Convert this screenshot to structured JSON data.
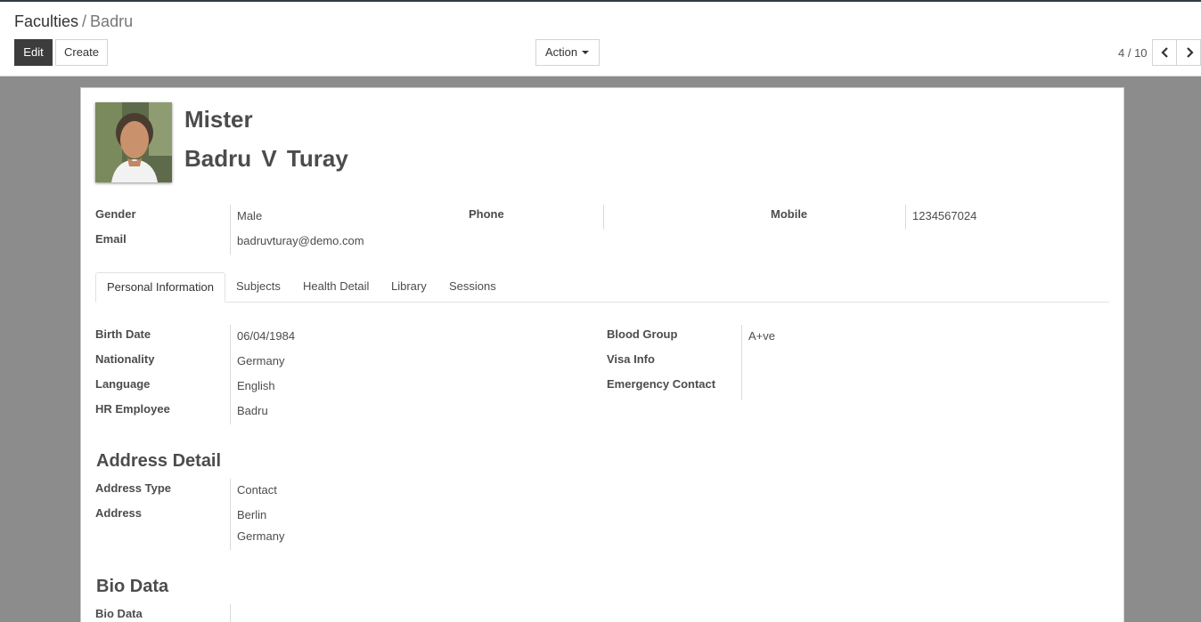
{
  "breadcrumb": {
    "parent": "Faculties",
    "separator": "/",
    "current": "Badru"
  },
  "toolbar": {
    "edit_label": "Edit",
    "create_label": "Create",
    "action_label": "Action"
  },
  "pager": {
    "value": "4 / 10"
  },
  "header": {
    "title": "Mister",
    "name": "Badru  V  Turay"
  },
  "contact": {
    "gender_label": "Gender",
    "gender_value": "Male",
    "phone_label": "Phone",
    "phone_value": "",
    "mobile_label": "Mobile",
    "mobile_value": "1234567024",
    "email_label": "Email",
    "email_value": "badruvturay@demo.com"
  },
  "tabs": [
    {
      "label": "Personal Information"
    },
    {
      "label": "Subjects"
    },
    {
      "label": "Health Detail"
    },
    {
      "label": "Library"
    },
    {
      "label": "Sessions"
    }
  ],
  "personal": {
    "birth_date_label": "Birth Date",
    "birth_date_value": "06/04/1984",
    "nationality_label": "Nationality",
    "nationality_value": "Germany",
    "language_label": "Language",
    "language_value": "English",
    "hr_employee_label": "HR Employee",
    "hr_employee_value": "Badru",
    "blood_group_label": "Blood Group",
    "blood_group_value": "A+ve",
    "visa_info_label": "Visa Info",
    "visa_info_value": "",
    "emergency_contact_label": "Emergency Contact",
    "emergency_contact_value": ""
  },
  "address": {
    "section_title": "Address Detail",
    "type_label": "Address Type",
    "type_value": "Contact",
    "address_label": "Address",
    "address_line1": "Berlin",
    "address_line2": "Germany"
  },
  "bio": {
    "section_title": "Bio Data",
    "label": "Bio Data",
    "value": ""
  },
  "colors": {
    "edit_button_bg": "#3c3c3c",
    "backdrop": "#8c8c8c",
    "top_bar": "#2f3b47"
  },
  "icons": {
    "pager_prev": "chevron-left-icon",
    "pager_next": "chevron-right-icon",
    "action_caret": "caret-down-icon"
  }
}
